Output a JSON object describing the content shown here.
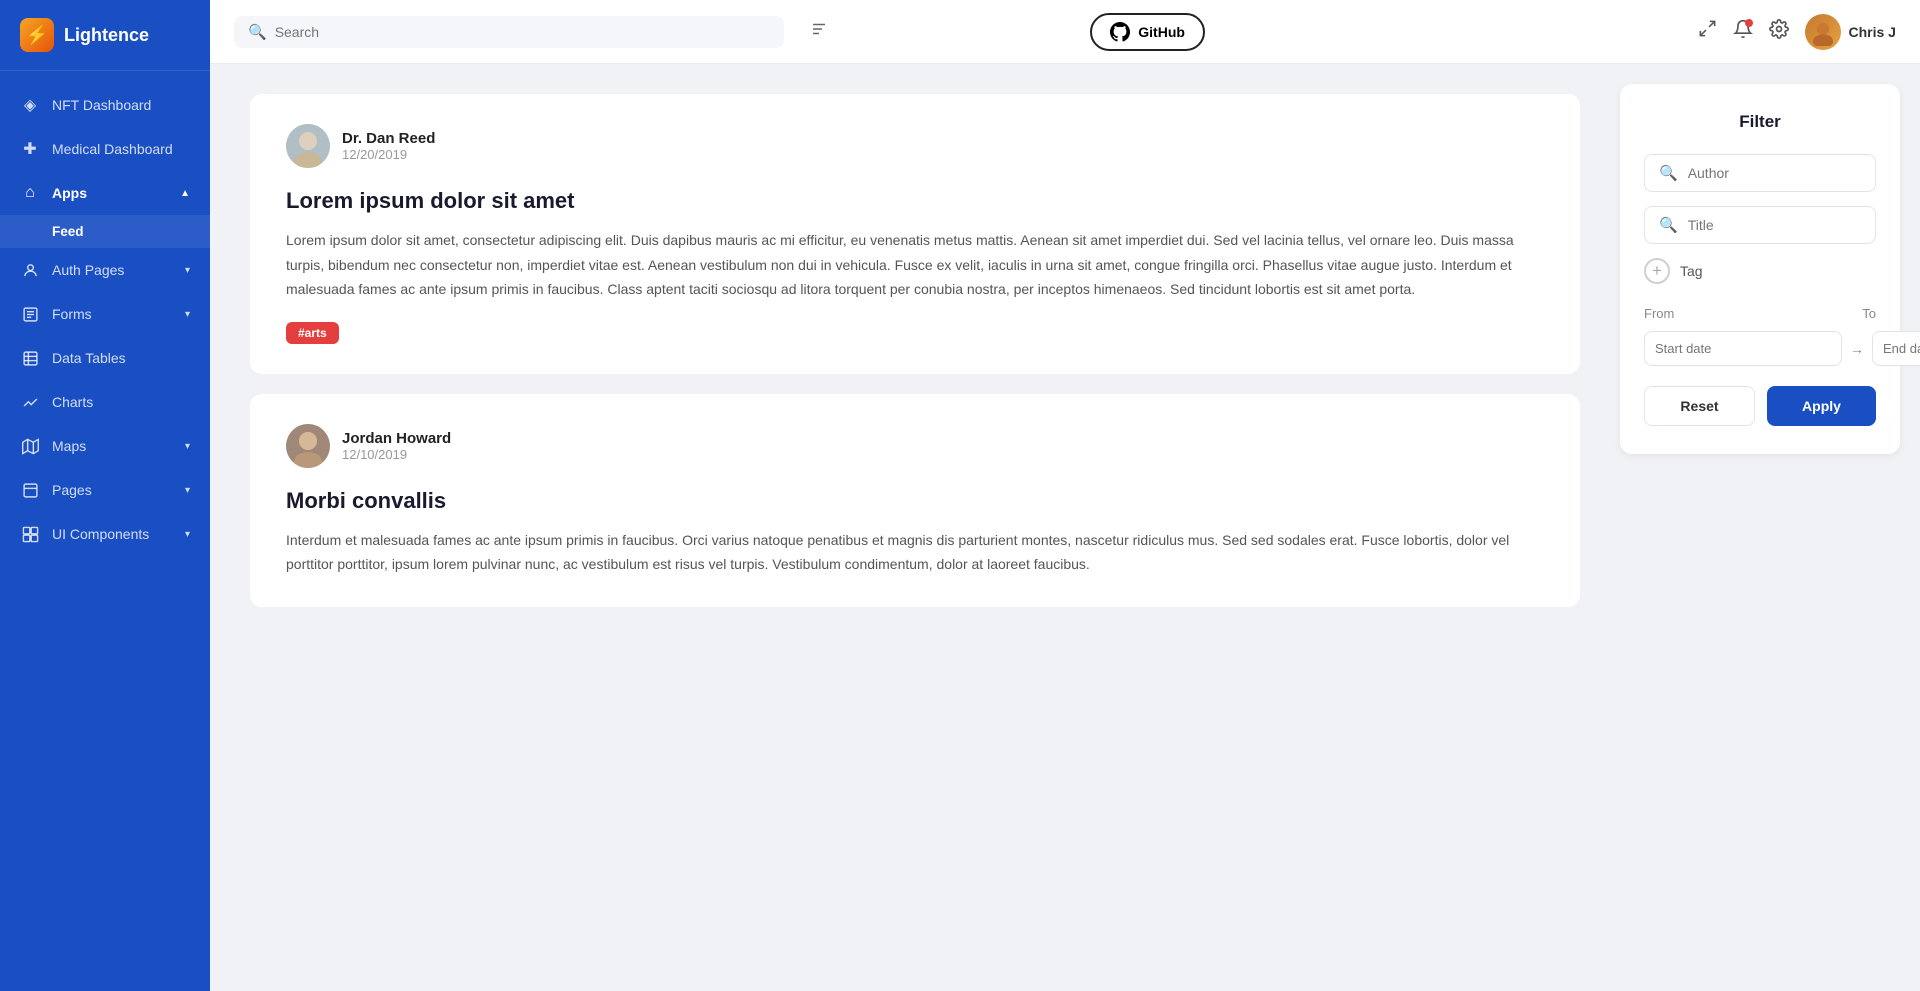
{
  "app": {
    "name": "Lightence"
  },
  "sidebar": {
    "logo": "L",
    "items": [
      {
        "id": "nft-dashboard",
        "label": "NFT Dashboard",
        "icon": "◈",
        "hasChevron": false
      },
      {
        "id": "medical-dashboard",
        "label": "Medical Dashboard",
        "icon": "⊕",
        "hasChevron": false
      },
      {
        "id": "apps",
        "label": "Apps",
        "icon": "⌂",
        "hasChevron": true,
        "expanded": true
      },
      {
        "id": "feed",
        "label": "Feed",
        "sub": true
      },
      {
        "id": "auth-pages",
        "label": "Auth Pages",
        "icon": "👤",
        "hasChevron": true
      },
      {
        "id": "forms",
        "label": "Forms",
        "icon": "☐",
        "hasChevron": true
      },
      {
        "id": "data-tables",
        "label": "Data Tables",
        "icon": "⊞",
        "hasChevron": false
      },
      {
        "id": "charts",
        "label": "Charts",
        "icon": "📈",
        "hasChevron": false
      },
      {
        "id": "maps",
        "label": "Maps",
        "icon": "🗺",
        "hasChevron": true
      },
      {
        "id": "pages",
        "label": "Pages",
        "icon": "☰",
        "hasChevron": true
      },
      {
        "id": "ui-components",
        "label": "UI Components",
        "icon": "⊟",
        "hasChevron": true
      }
    ]
  },
  "header": {
    "search_placeholder": "Search",
    "github_label": "GitHub",
    "user_name": "Chris J"
  },
  "filter": {
    "title": "Filter",
    "author_placeholder": "Author",
    "title_placeholder": "Title",
    "tag_label": "Tag",
    "from_label": "From",
    "to_label": "To",
    "start_date_placeholder": "Start date",
    "end_date_placeholder": "End date",
    "reset_label": "Reset",
    "apply_label": "Apply"
  },
  "articles": [
    {
      "id": "article-1",
      "author_name": "Dr. Dan Reed",
      "author_date": "12/20/2019",
      "title": "Lorem ipsum dolor sit amet",
      "body": "Lorem ipsum dolor sit amet, consectetur adipiscing elit. Duis dapibus mauris ac mi efficitur, eu venenatis metus mattis. Aenean sit amet imperdiet dui. Sed vel lacinia tellus, vel ornare leo. Duis massa turpis, bibendum nec consectetur non, imperdiet vitae est. Aenean vestibulum non dui in vehicula. Fusce ex velit, iaculis in urna sit amet, congue fringilla orci. Phasellus vitae augue justo. Interdum et malesuada fames ac ante ipsum primis in faucibus. Class aptent taciti sociosqu ad litora torquent per conubia nostra, per inceptos himenaeos. Sed tincidunt lobortis est sit amet porta.",
      "tags": [
        "#arts"
      ]
    },
    {
      "id": "article-2",
      "author_name": "Jordan Howard",
      "author_date": "12/10/2019",
      "title": "Morbi convallis",
      "body": "Interdum et malesuada fames ac ante ipsum primis in faucibus. Orci varius natoque penatibus et magnis dis parturient montes, nascetur ridiculus mus. Sed sed sodales erat. Fusce lobortis, dolor vel porttitor porttitor, ipsum lorem pulvinar nunc, ac vestibulum est risus vel turpis. Vestibulum condimentum, dolor at laoreet faucibus.",
      "tags": []
    }
  ]
}
